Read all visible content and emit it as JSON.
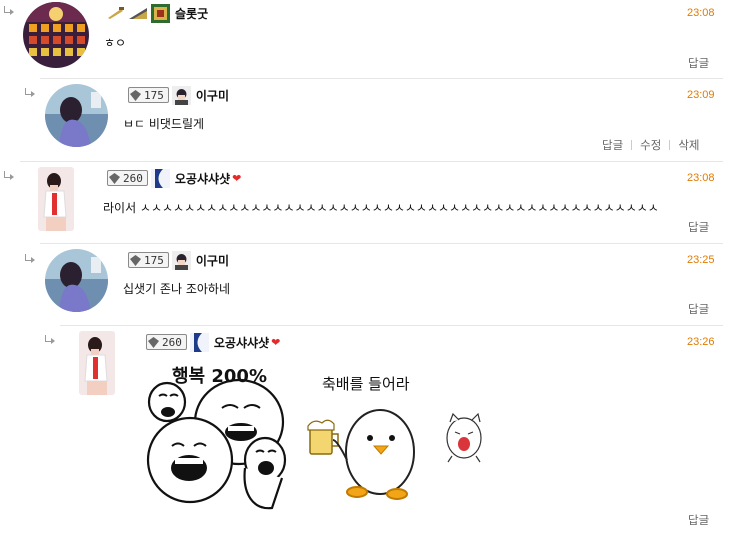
{
  "comments": [
    {
      "nickname": "슬롯굿",
      "time": "23:08",
      "text": "ㅎㅇ",
      "actions": [
        "답글"
      ]
    },
    {
      "level": "175",
      "nickname": "이구미",
      "time": "23:09",
      "text": "ㅂㄷ 비댓드릴게",
      "actions": [
        "답글",
        "수정",
        "삭제"
      ]
    },
    {
      "level": "260",
      "nickname": "오공샤샤샷",
      "time": "23:08",
      "text": "라이서 ㅅㅅㅅㅅㅅㅅㅅㅅㅅㅅㅅㅅㅅㅅㅅㅅㅅㅅㅅㅅㅅㅅㅅㅅㅅㅅㅅㅅㅅㅅㅅㅅㅅㅅㅅㅅㅅㅅㅅㅅㅅㅅㅅㅅㅅㅅㅅ",
      "actions": [
        "답글"
      ]
    },
    {
      "level": "175",
      "nickname": "이구미",
      "time": "23:25",
      "text": "십샛기 존나 조아하네",
      "actions": [
        "답글"
      ]
    },
    {
      "level": "260",
      "nickname": "오공샤샤샷",
      "time": "23:26",
      "sticker": {
        "left_caption": "행복 200%",
        "right_caption": "축배를 들어라"
      },
      "actions": [
        "답글"
      ]
    }
  ],
  "colors": {
    "time": "#e07b00",
    "heart": "#e52a2a",
    "divider": "#e6e6e6"
  }
}
